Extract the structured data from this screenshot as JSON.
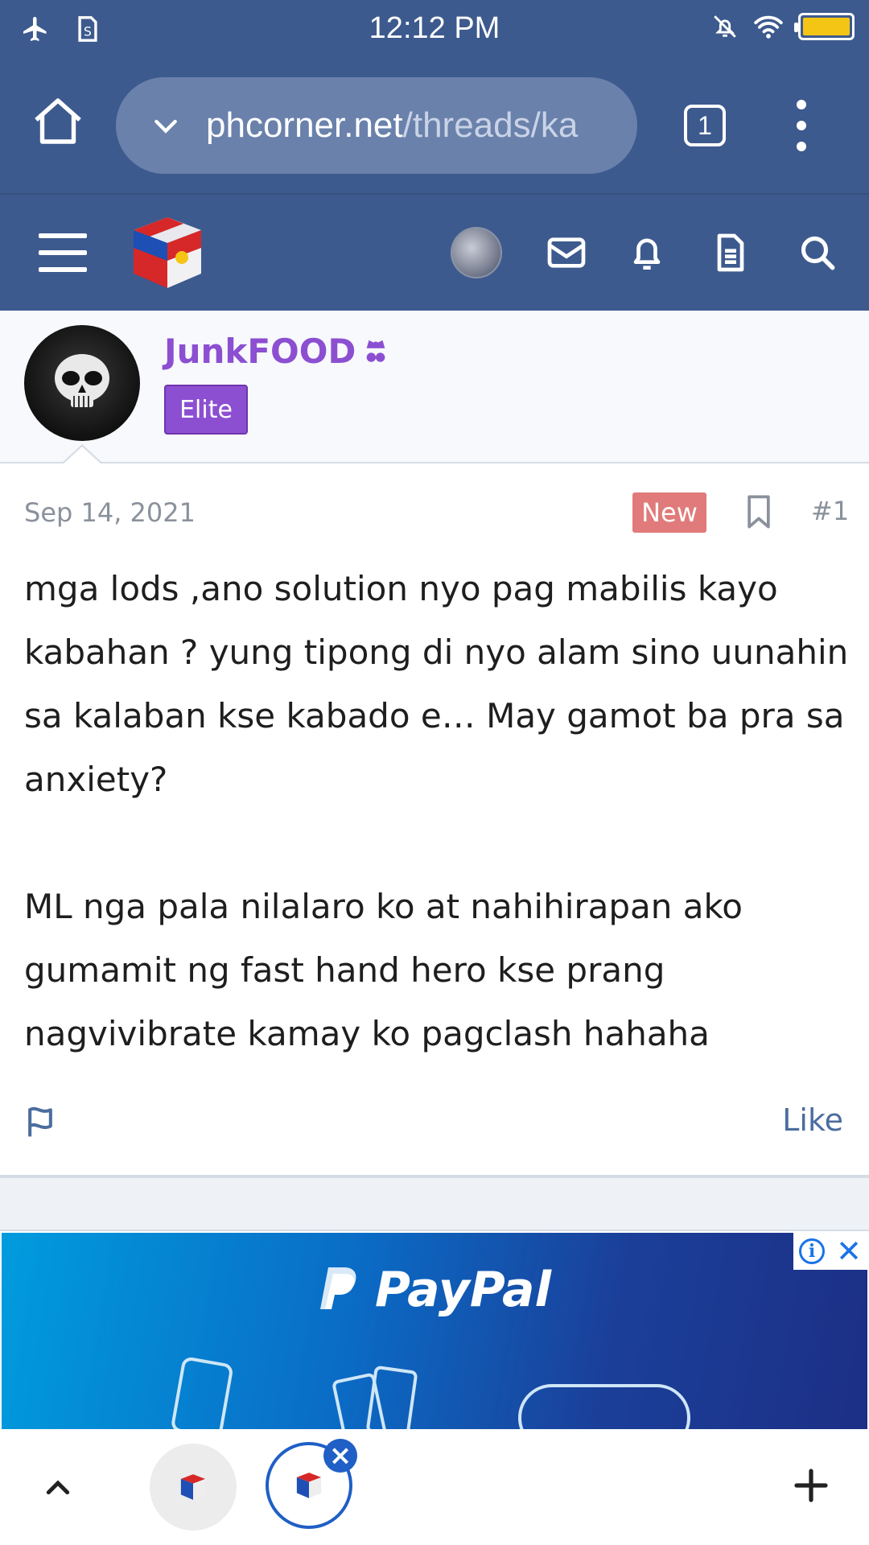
{
  "status_bar": {
    "time": "12:12 PM",
    "icons": [
      "airplane-icon",
      "sim-icon",
      "mute-notification-icon",
      "wifi-icon",
      "battery-icon"
    ],
    "battery_color": "#f4c514"
  },
  "browser": {
    "url_host": "phcorner.net",
    "url_path": "/threads/ka",
    "tab_count": "1",
    "toolbar_color": "#3d5a8e",
    "url_pill_color": "#6a81ab"
  },
  "site_header": {
    "icons": [
      "menu-icon",
      "site-logo",
      "user-avatar",
      "inbox-icon",
      "bell-icon",
      "document-icon",
      "search-icon"
    ]
  },
  "post": {
    "author": "JunkFOOD",
    "author_color": "#8c4fd1",
    "badge": "Elite",
    "date": "Sep 14, 2021",
    "new_label": "New",
    "post_number": "#1",
    "paragraph1": "mga lods ,ano solution nyo pag mabilis kayo kabahan ? yung tipong di nyo alam sino uunahin sa kalaban kse kabado e… May gamot ba pra sa anxiety?",
    "paragraph2": "ML nga pala nilalaro ko at nahihirapan ako gumamit ng fast hand hero kse prang nagvivibrate kamay ko pagclash hahaha",
    "like_label": "Like"
  },
  "ad": {
    "brand": "PayPal"
  },
  "tab_bar": {
    "icons": [
      "scroll-up-icon",
      "tab-thumbnail",
      "active-tab-thumbnail",
      "close-tab-icon",
      "new-tab-icon"
    ]
  }
}
